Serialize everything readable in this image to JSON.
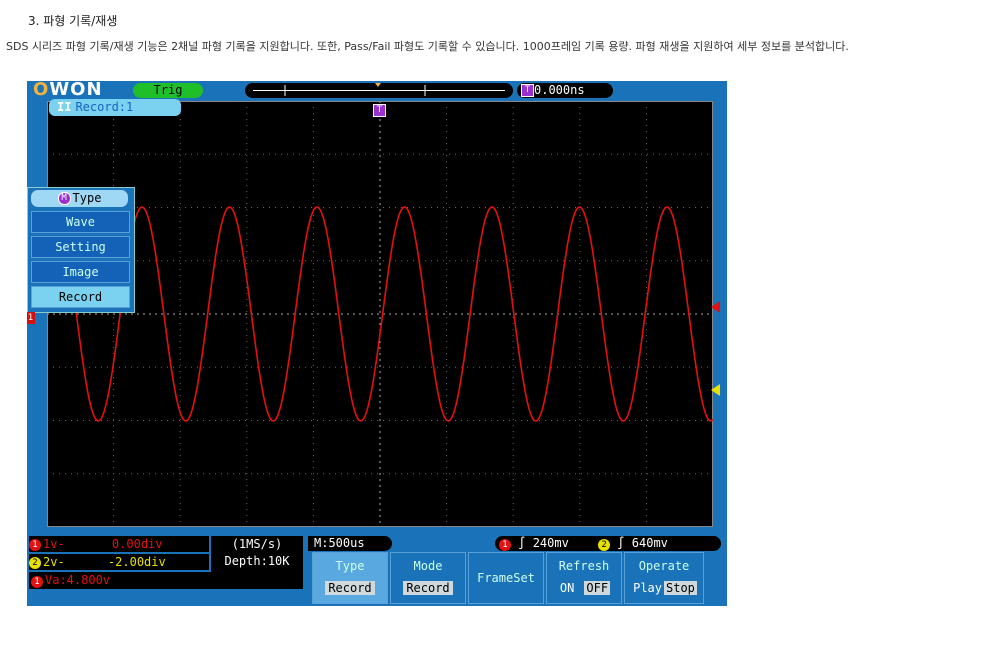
{
  "page": {
    "heading": "3. 파형 기록/재생",
    "description": "SDS 시리즈 파형 기록/재생 기능은 2채널 파형 기록을 지원합니다. 또한, Pass/Fail 파형도 기록할 수 있습니다. 1000프레임 기록 용량. 파형 재생을 지원하여 세부 정보를 분석합니다."
  },
  "scope": {
    "logo": "OWON",
    "trig_label": "Trig",
    "time_offset": "0.000ns",
    "record_status": "Record:1",
    "menu": {
      "title": "Type",
      "items": [
        "Wave",
        "Setting",
        "Image",
        "Record"
      ],
      "selected": "Record"
    },
    "status": {
      "ch1": {
        "label": "1v-",
        "value": "0.00div"
      },
      "ch2": {
        "label": "2v-",
        "value": "-2.00div"
      },
      "sample_rate": "(1MS/s)",
      "depth": "Depth:10K",
      "timebase": "M:500us",
      "trig1": "240mv",
      "trig2": "640mv",
      "va": "Va:4.800v"
    },
    "softkeys": [
      {
        "label": "Type",
        "value": "Record"
      },
      {
        "label": "Mode",
        "value": "Record"
      },
      {
        "label": "FrameSet",
        "value": ""
      },
      {
        "label": "Refresh",
        "options": [
          "ON",
          "OFF"
        ],
        "active": "OFF"
      },
      {
        "label": "Operate",
        "options": [
          "Play",
          "Stop"
        ],
        "active": "Stop"
      }
    ],
    "colors": {
      "ch1": "#e31111",
      "ch2": "#e8e000",
      "frame": "#1a73b8",
      "trig": "#1fbf2a"
    }
  }
}
